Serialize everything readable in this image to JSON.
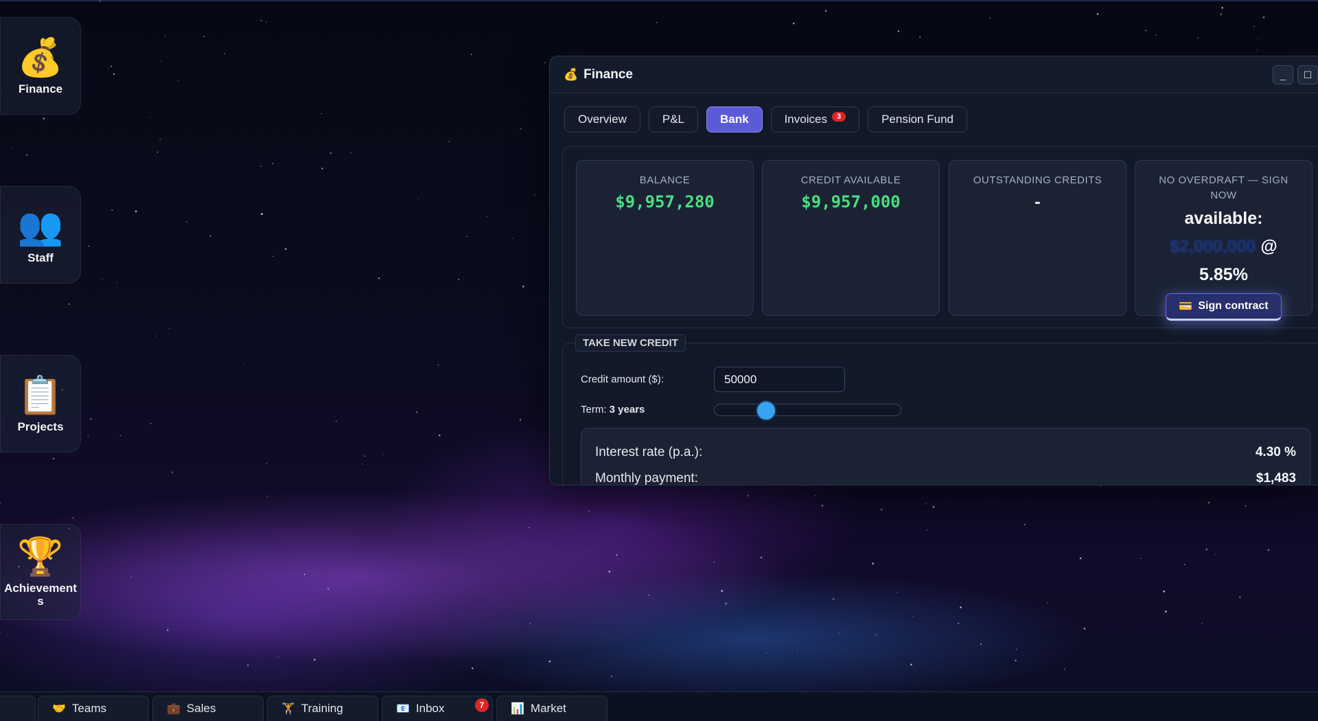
{
  "desktop": {
    "icons": [
      {
        "label": "Finance",
        "glyph": "💰",
        "icon": "money-bag-icon"
      },
      {
        "label": "Staff",
        "glyph": "👥",
        "icon": "people-icon"
      },
      {
        "label": "Projects",
        "glyph": "📋",
        "icon": "clipboard-icon"
      },
      {
        "label": "Achievements",
        "glyph": "🏆",
        "icon": "trophy-icon"
      }
    ]
  },
  "window": {
    "title": "Finance",
    "title_icon": "💰",
    "minimize": "_",
    "maximize": "☐",
    "tabs": [
      {
        "label": "Overview"
      },
      {
        "label": "P&L"
      },
      {
        "label": "Bank",
        "active": true
      },
      {
        "label": "Invoices",
        "badge": "3"
      },
      {
        "label": "Pension Fund"
      }
    ],
    "cards": {
      "balance": {
        "title": "BALANCE",
        "value": "$9,957,280"
      },
      "credit_available": {
        "title": "CREDIT AVAILABLE",
        "value": "$9,957,000"
      },
      "outstanding": {
        "title": "OUTSTANDING CREDITS",
        "value": "-"
      },
      "overdraft": {
        "title": "NO OVERDRAFT — SIGN NOW",
        "available_label": "available:",
        "amount": "$2,000,000",
        "at": "@",
        "rate": "5.85%",
        "button_icon": "💳",
        "button_label": "Sign contract"
      }
    },
    "new_credit": {
      "legend": "TAKE NEW CREDIT",
      "amount_label": "Credit amount ($):",
      "amount_value": "50000",
      "term_label": "Term:",
      "term_value": "3 years",
      "term_fraction": 0.25,
      "interest_label": "Interest rate (p.a.):",
      "interest_value": "4.30 %",
      "monthly_label": "Monthly payment:",
      "monthly_value": "$1,483"
    }
  },
  "taskbar": {
    "items": [
      {
        "label": "Teams",
        "glyph": "🤝"
      },
      {
        "label": "Sales",
        "glyph": "💼"
      },
      {
        "label": "Training",
        "glyph": "🏋"
      },
      {
        "label": "Inbox",
        "glyph": "📧",
        "badge": "7"
      },
      {
        "label": "Market",
        "glyph": "📊"
      }
    ]
  },
  "colors": {
    "accent": "#5b5bd6",
    "positive": "#4ade80",
    "slider": "#38a3f1",
    "badge": "#dc2626"
  }
}
